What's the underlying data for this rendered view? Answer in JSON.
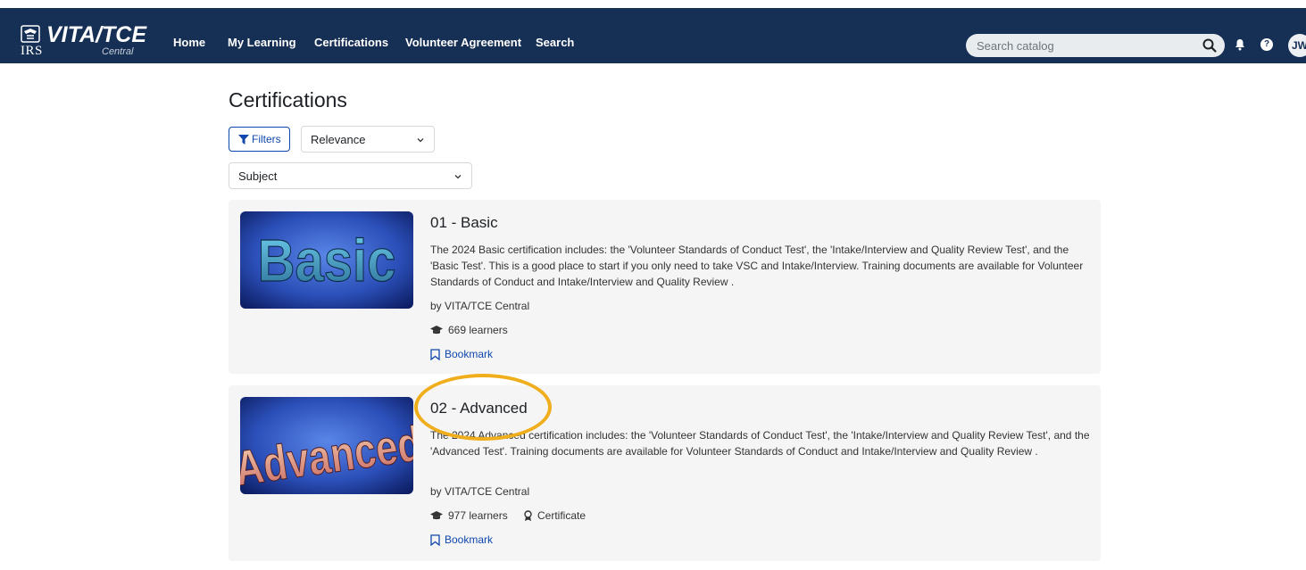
{
  "brand": {
    "irs": "IRS",
    "title": "VITA/TCE",
    "subtitle": "Central"
  },
  "nav": {
    "items": [
      "Home",
      "My Learning",
      "Certifications",
      "Volunteer Agreement",
      "Search"
    ]
  },
  "search": {
    "placeholder": "Search catalog"
  },
  "user": {
    "initials": "JW",
    "help_label": "?"
  },
  "page": {
    "title": "Certifications",
    "filters_label": "Filters",
    "sort_value": "Relevance",
    "subject_value": "Subject"
  },
  "courses": [
    {
      "thumb_text": "Basic",
      "title": "01 - Basic",
      "description": "The 2024 Basic certification includes: the 'Volunteer Standards of Conduct Test', the 'Intake/Interview and Quality Review Test', and the 'Basic Test'. This is a good place to start if you only need to take VSC and Intake/Interview. Training documents are available for Volunteer Standards of Conduct and Intake/Interview and Quality Review .",
      "by": "by VITA/TCE Central",
      "learners": "669 learners",
      "certificate": "",
      "bookmark": "Bookmark"
    },
    {
      "thumb_text": "Advanced",
      "title": "02 - Advanced",
      "description": "The 2024 Advanced certification includes: the 'Volunteer Standards of Conduct Test', the 'Intake/Interview and Quality Review Test', and the 'Advanced Test'. Training documents are available for Volunteer Standards of Conduct and Intake/Interview and Quality Review .",
      "by": "by VITA/TCE Central",
      "learners": "977 learners",
      "certificate": "Certificate",
      "bookmark": "Bookmark"
    }
  ],
  "colors": {
    "header_bg": "#162f54",
    "link": "#0f47ad",
    "card_bg": "#f5f5f5",
    "highlight": "#f0ad1c"
  }
}
